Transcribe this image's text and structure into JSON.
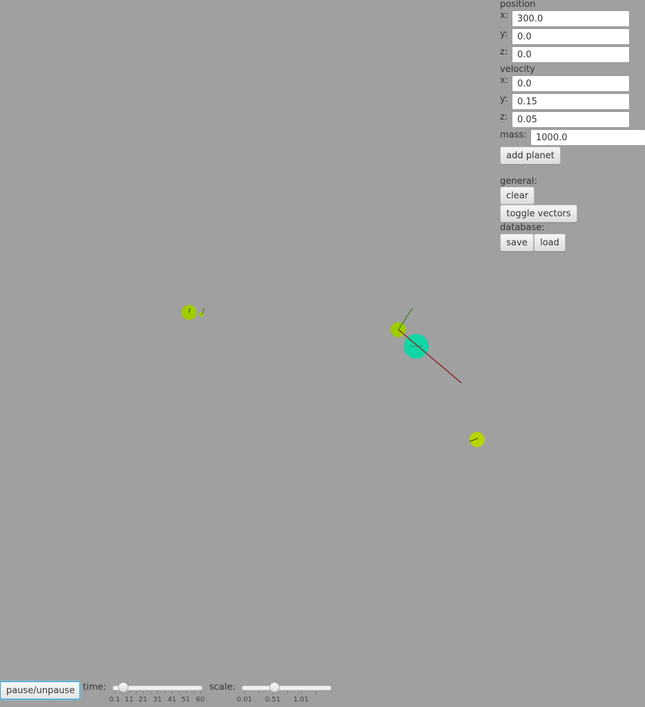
{
  "panel": {
    "position_header": "position",
    "velocity_header": "velocity",
    "axis_labels": {
      "x": "x:",
      "y": "y:",
      "z": "z:"
    },
    "position": {
      "x": "300.0",
      "y": "0.0",
      "z": "0.0"
    },
    "velocity": {
      "x": "0.0",
      "y": "0.15",
      "z": "0.05"
    },
    "mass_label": "mass:",
    "mass": "1000.0",
    "add_planet_label": "add planet",
    "general_header": "general:",
    "clear_label": "clear",
    "toggle_vectors_label": "toggle vectors",
    "database_header": "database:",
    "save_label": "save",
    "load_label": "load"
  },
  "bottom": {
    "pause_label": "pause/unpause",
    "time_label": "time:",
    "time_ticks": [
      "0.1",
      "11",
      "21",
      "31",
      "41",
      "51",
      "60"
    ],
    "time_value": 6.0,
    "time_range": [
      0.1,
      60
    ],
    "scale_label": "scale:",
    "scale_ticks": [
      "0.01",
      "0.51",
      "1.01"
    ],
    "scale_value": 0.53,
    "scale_range": [
      0.01,
      1.5
    ]
  },
  "colors": {
    "background": "#a0a0a0",
    "planet": "#9ecc00",
    "central_body": "#12d5a6",
    "force_vector": "#8b1010",
    "velocity_vector": "#3a7d1c"
  }
}
